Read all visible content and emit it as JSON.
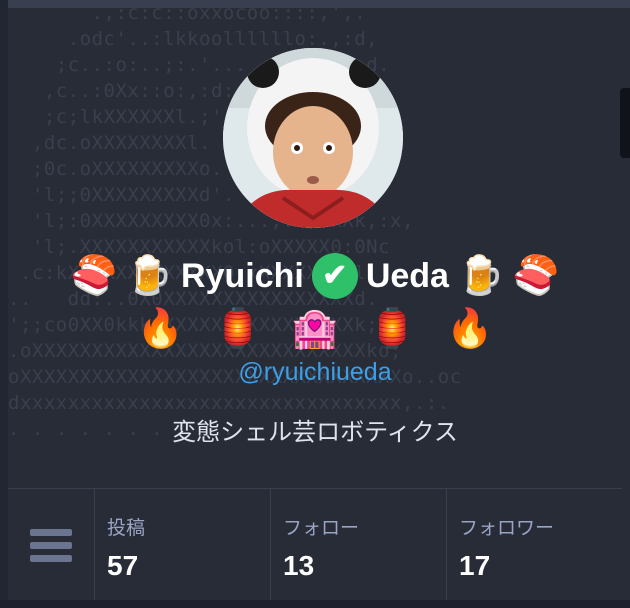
{
  "ascii_art_lines": [
    "       .,:c:c::oxxocoo::::,',.",
    "     .odc'..:lkkoollllllo:.,:d,",
    "    ;c..:o:..;:.'... .,l,  ..:d.",
    "   ,c..:0Xx::o:,:d:...,c  ..'cx;",
    "   ;c;lkXXXXXXl.;'      ..':l,:c.",
    "  ,dc.oXXXXXXXXl. .       ..:0",
    "  ;0c.oXXXXXXXXXo. .',  .,odxO:",
    "  'l;;0XXXXXXXXXd'. ,dxo. .,.,l'",
    "  'l;:0XXXXXXXXX0x:...,..;ckXk,:x,",
    "  'l;.XXXXXXXXXXXkol:oXXXXX0:0Nc",
    " .c:kXXXXXXXXXXXXX0:xXXXXXXX0l.",
    "..   dd:..0X0XXXXXXXXXXXXXXXXd.",
    "';;co0XX0kkkxXXXXXXXXXXXXXXXXk;.",
    ".oXXXXXXXXXXXXXXXXXXXXXXXXXXXXko;",
    "oXXXXXXXXXXXXXXXXXXXXXXXXXXXXXXXXo..oc",
    "dxxxxxxxxxxxxxxxxxxxxxxxxxxxxxxxx,.:.",
    ". . . . . . . . . . . . . . . . . ."
  ],
  "profile": {
    "name_first": "Ryuichi",
    "name_last": "Ueda",
    "emoji_row1": [
      "🍣",
      "🍺",
      "🍺",
      "🍣"
    ],
    "verified_mark": "✔",
    "emoji_row2": [
      "🔥",
      "🏮",
      "🏩",
      "🏮",
      "🔥"
    ],
    "handle": "@ryuichiueda",
    "bio": "変態シェル芸ロボティクス"
  },
  "stats": [
    {
      "label": "投稿",
      "value": "57"
    },
    {
      "label": "フォロー",
      "value": "13"
    },
    {
      "label": "フォロワー",
      "value": "17"
    }
  ],
  "icons": [
    "menu-icon",
    "verified-icon"
  ],
  "colors": {
    "background": "#282c37",
    "handle": "#3d9fe6",
    "verified": "#2ec16a",
    "stat_label": "#9aa4c4"
  }
}
